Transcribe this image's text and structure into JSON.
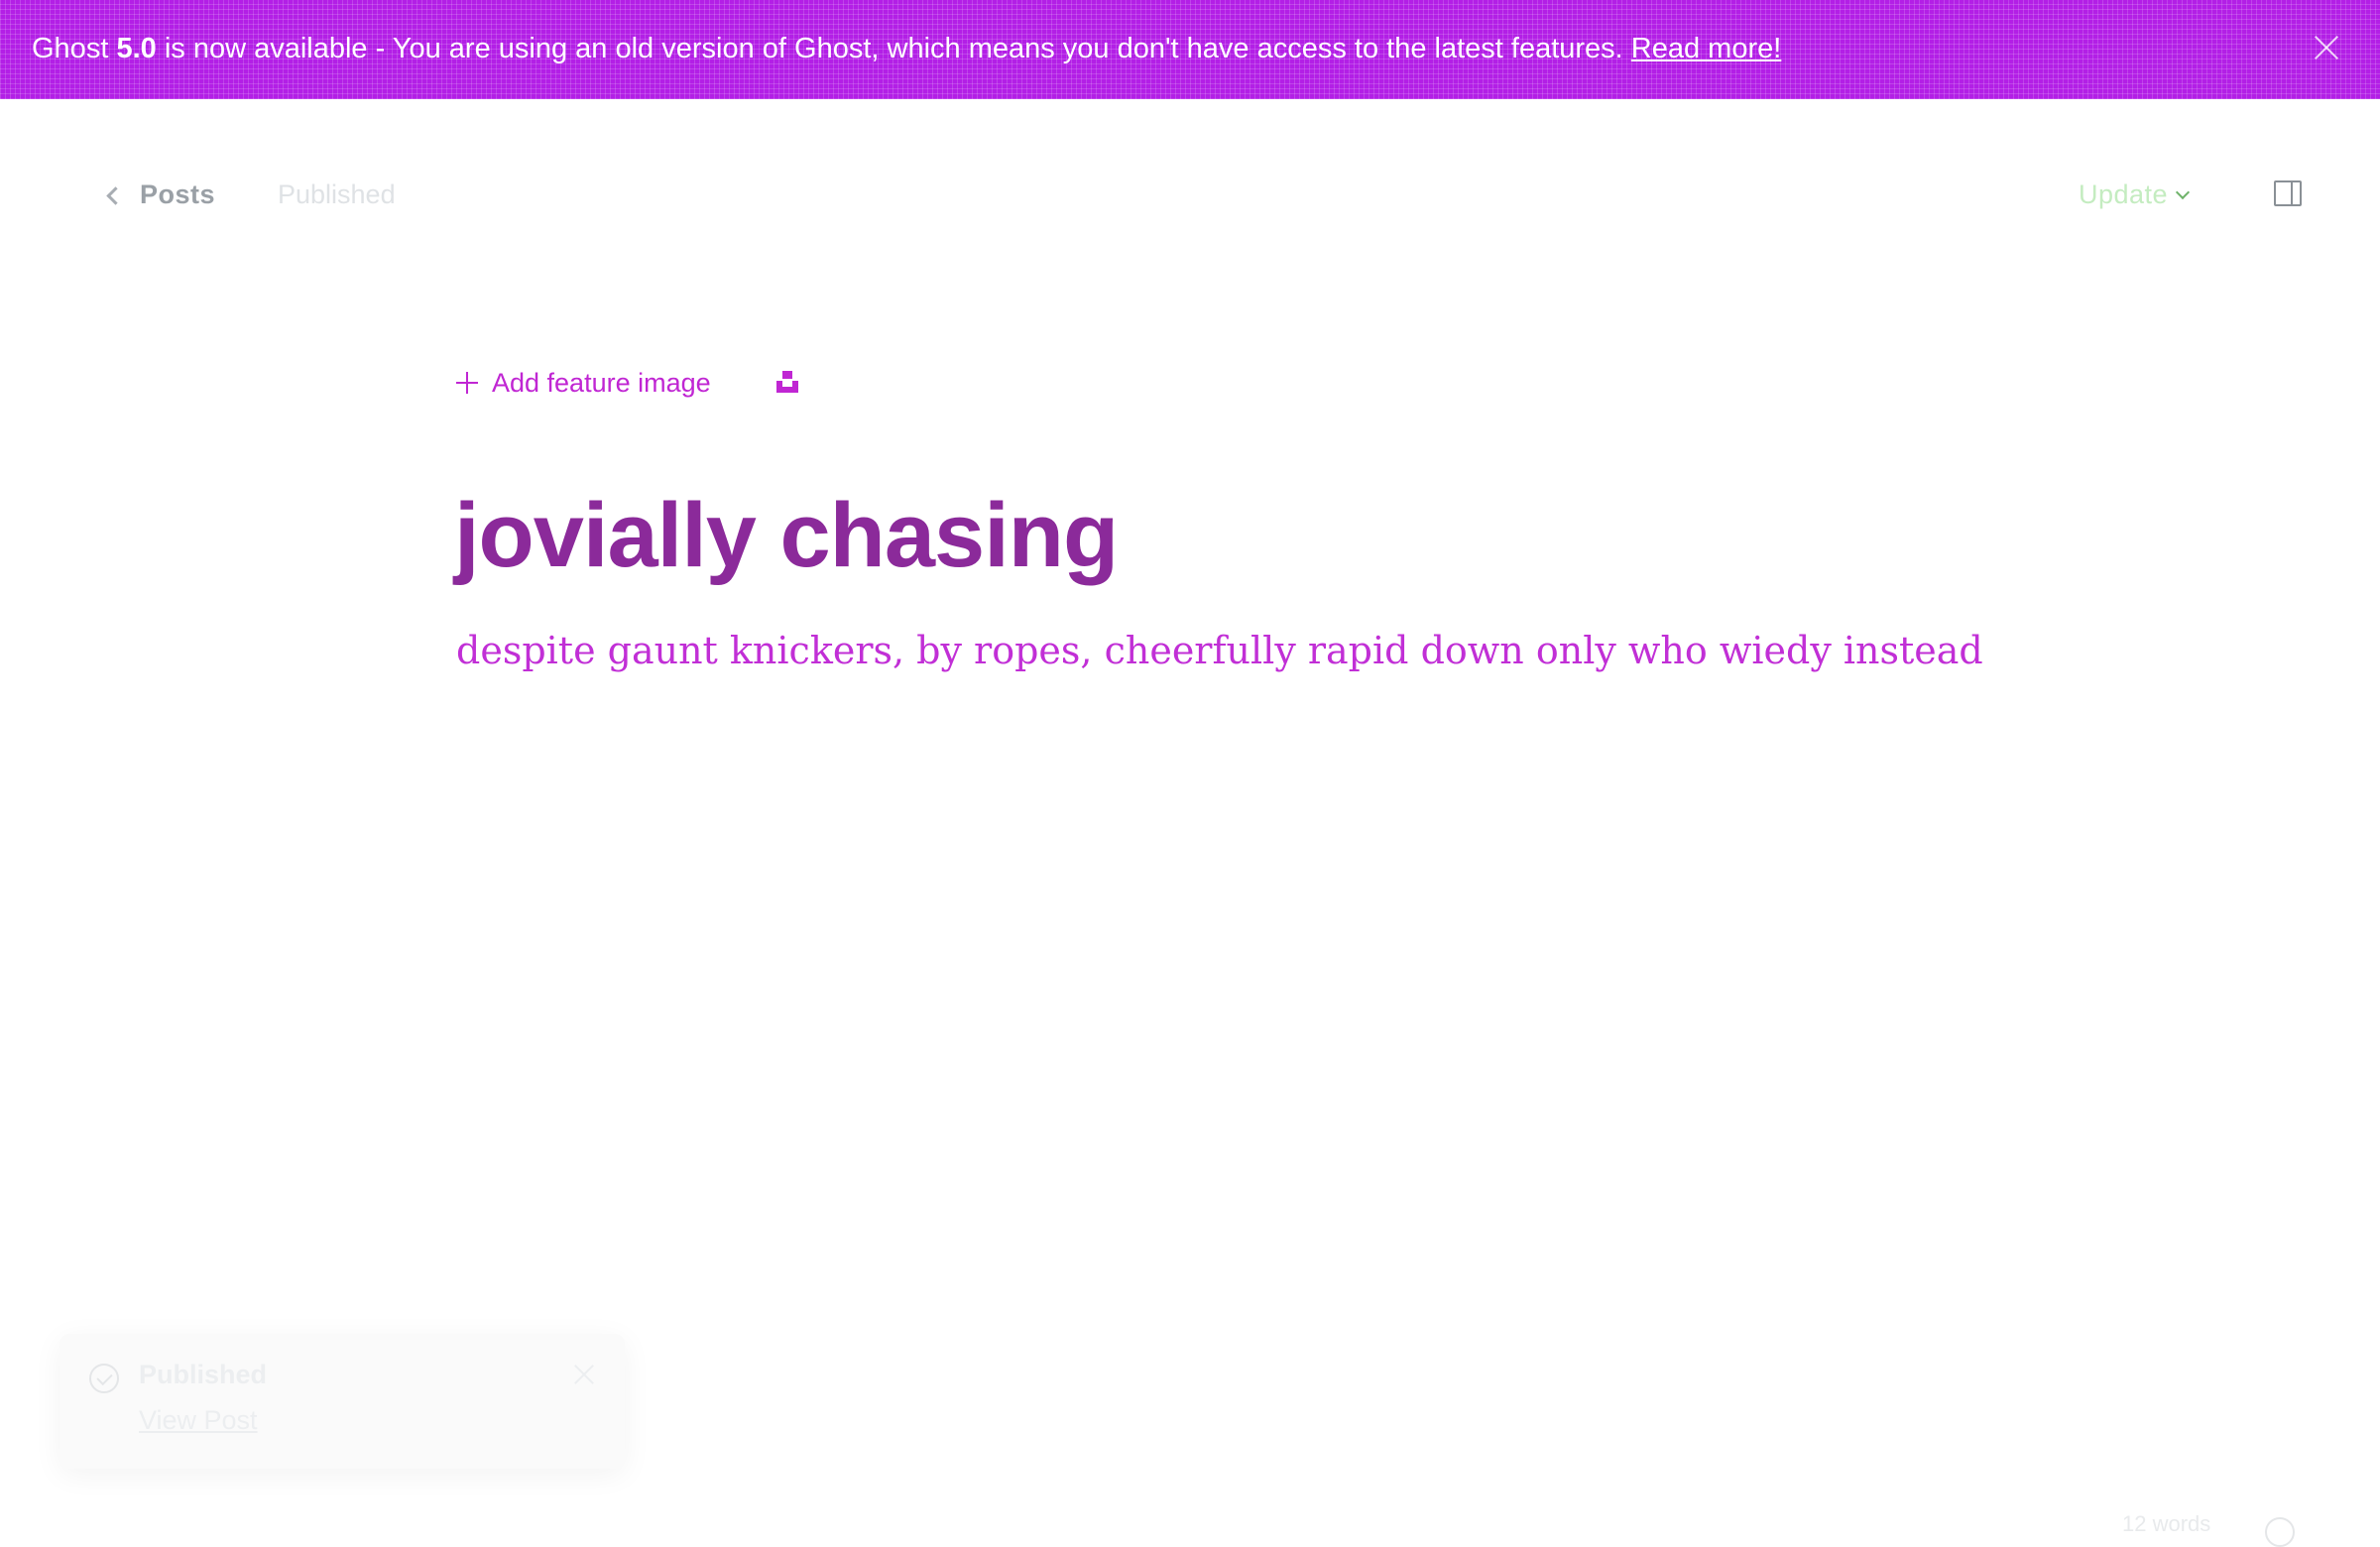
{
  "banner": {
    "text_prefix": "Ghost ",
    "version": "5.0",
    "text_mid": " is now available",
    "text_body": " - You are using an old version of Ghost, which means you don't have access to the latest features. ",
    "link_label": "Read more!",
    "background_color": "#b31fe6"
  },
  "header": {
    "back_label": "Posts",
    "status": "Published",
    "update_label": "Update"
  },
  "editor": {
    "add_feature_image_label": "Add feature image",
    "title": "jovially chasing",
    "excerpt": "despite gaunt knickers, by ropes, cheerfully rapid down only who wiedy instead"
  },
  "toast": {
    "title": "Published",
    "link_label": "View Post"
  },
  "footer": {
    "word_count": "12 words"
  },
  "icons": {
    "back": "chevron-left-icon",
    "update_dropdown": "chevron-down-icon",
    "sidebar": "sidebar-toggle-icon",
    "add_feature": "plus-icon",
    "unsplash": "unsplash-icon",
    "banner_close": "close-icon",
    "toast_check": "check-circle-icon",
    "toast_close": "close-icon",
    "help": "help-icon"
  },
  "colors": {
    "accent": "#c026d3",
    "update": "#30cf43"
  }
}
